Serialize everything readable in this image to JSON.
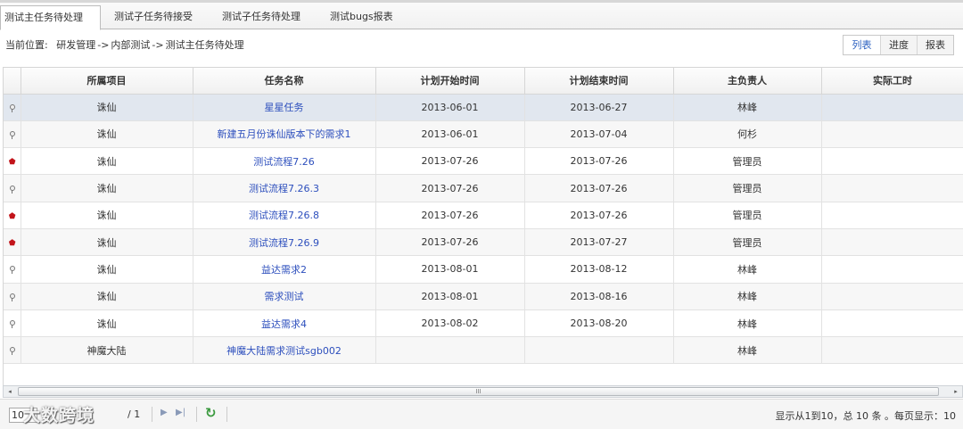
{
  "tabs": [
    {
      "label": "测试主任务待处理",
      "active": true
    },
    {
      "label": "测试子任务待接受",
      "active": false
    },
    {
      "label": "测试子任务待处理",
      "active": false
    },
    {
      "label": "测试bugs报表",
      "active": false
    }
  ],
  "breadcrumb": {
    "prefix": "当前位置:",
    "items": [
      "研发管理",
      "内部测试",
      "测试主任务待处理"
    ],
    "separator": "->"
  },
  "view_buttons": [
    "列表",
    "进度",
    "报表"
  ],
  "table": {
    "columns": [
      "所属项目",
      "任务名称",
      "计划开始时间",
      "计划结束时间",
      "主负责人",
      "实际工时"
    ],
    "rows": [
      {
        "flag": "plain",
        "project": "诛仙",
        "task": "星星任务",
        "start": "2013-06-01",
        "end": "2013-06-27",
        "owner": "林峰",
        "hours": ""
      },
      {
        "flag": "plain",
        "project": "诛仙",
        "task": "新建五月份诛仙版本下的需求1",
        "start": "2013-06-01",
        "end": "2013-07-04",
        "owner": "何杉",
        "hours": ""
      },
      {
        "flag": "red",
        "project": "诛仙",
        "task": "测试流程7.26",
        "start": "2013-07-26",
        "end": "2013-07-26",
        "owner": "管理员",
        "hours": ""
      },
      {
        "flag": "plain",
        "project": "诛仙",
        "task": "测试流程7.26.3",
        "start": "2013-07-26",
        "end": "2013-07-26",
        "owner": "管理员",
        "hours": ""
      },
      {
        "flag": "red",
        "project": "诛仙",
        "task": "测试流程7.26.8",
        "start": "2013-07-26",
        "end": "2013-07-26",
        "owner": "管理员",
        "hours": ""
      },
      {
        "flag": "red",
        "project": "诛仙",
        "task": "测试流程7.26.9",
        "start": "2013-07-26",
        "end": "2013-07-27",
        "owner": "管理员",
        "hours": ""
      },
      {
        "flag": "plain",
        "project": "诛仙",
        "task": "益达需求2",
        "start": "2013-08-01",
        "end": "2013-08-12",
        "owner": "林峰",
        "hours": ""
      },
      {
        "flag": "plain",
        "project": "诛仙",
        "task": "需求测试",
        "start": "2013-08-01",
        "end": "2013-08-16",
        "owner": "林峰",
        "hours": ""
      },
      {
        "flag": "plain",
        "project": "诛仙",
        "task": "益达需求4",
        "start": "2013-08-02",
        "end": "2013-08-20",
        "owner": "林峰",
        "hours": ""
      },
      {
        "flag": "plain",
        "project": "神魔大陆",
        "task": "神魔大陆需求测试sgb002",
        "start": "",
        "end": "",
        "owner": "林峰",
        "hours": ""
      }
    ]
  },
  "scrollbar": {
    "grip": "III"
  },
  "pager": {
    "page_size": "10",
    "watermark": "大数跨境",
    "page_total": "/ 1",
    "info": "显示从1到10，总 10 条 。每页显示：10"
  },
  "colors": {
    "link": "#2d4fbd",
    "selected_row": "#e1e7ef",
    "red_flag": "#c2141a"
  }
}
